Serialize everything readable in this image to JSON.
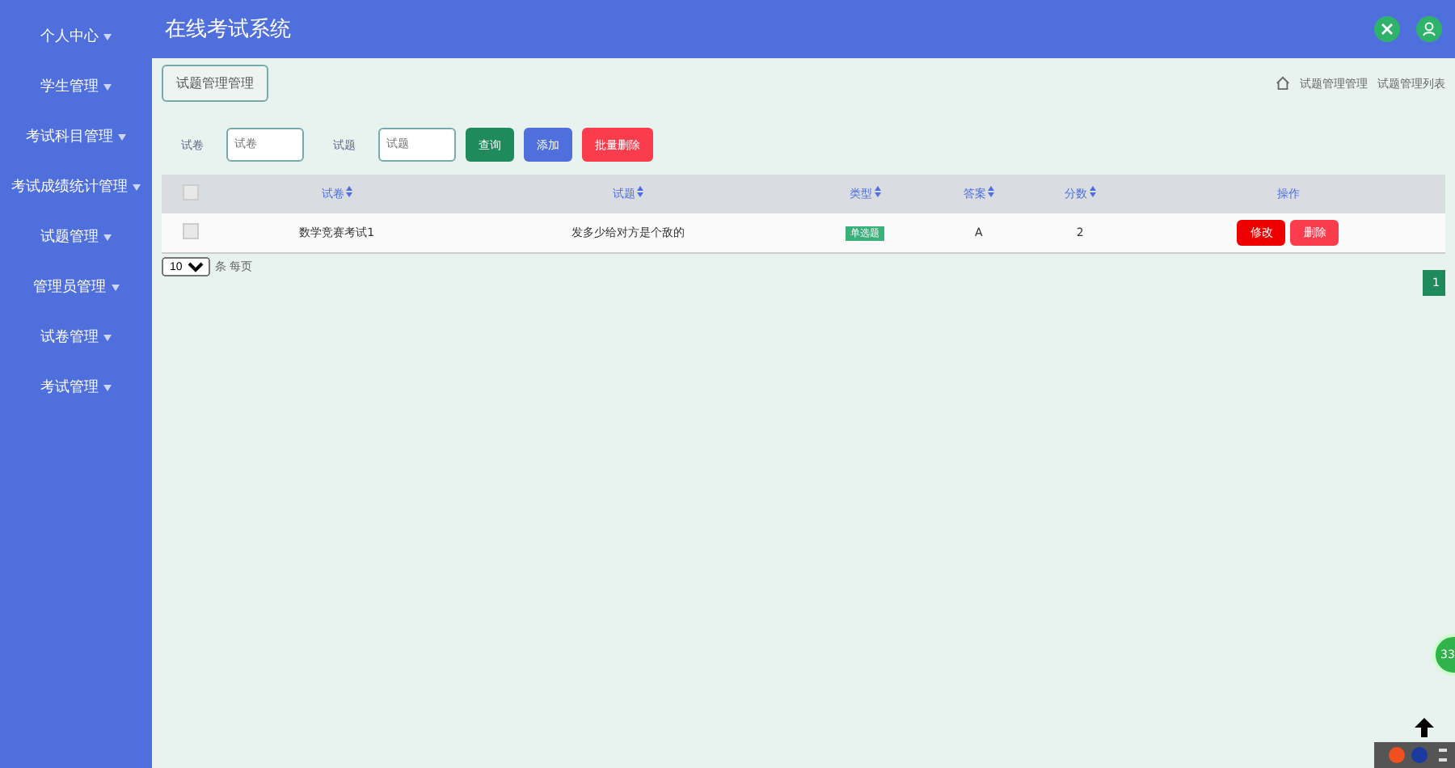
{
  "sidebar": {
    "items": [
      {
        "label": "个人中心"
      },
      {
        "label": "学生管理"
      },
      {
        "label": "考试科目管理"
      },
      {
        "label": "考试成绩统计管理"
      },
      {
        "label": "试题管理"
      },
      {
        "label": "管理员管理"
      },
      {
        "label": "试卷管理"
      },
      {
        "label": "考试管理"
      }
    ]
  },
  "header": {
    "title": "在线考试系统"
  },
  "page_tab": "试题管理管理",
  "breadcrumb": [
    "试题管理管理",
    "试题管理列表"
  ],
  "search": {
    "fields": [
      {
        "label": "试卷",
        "placeholder": "试卷"
      },
      {
        "label": "试题",
        "placeholder": "试题"
      }
    ],
    "buttons": [
      {
        "label": "查询",
        "kind": "query"
      },
      {
        "label": "添加",
        "kind": "add"
      },
      {
        "label": "批量删除",
        "kind": "delete"
      }
    ]
  },
  "table": {
    "all_checked": false,
    "columns": [
      "试卷",
      "试题",
      "类型",
      "答案",
      "分数",
      "操作"
    ],
    "rows": [
      {
        "checked": false,
        "cells": [
          "数学竞赛考试1",
          "发多少给对方是个敌的",
          "单选题",
          "A",
          "2"
        ],
        "actions": [
          {
            "label": "修改",
            "kind": "edit"
          },
          {
            "label": "删除",
            "kind": "delete"
          }
        ]
      }
    ]
  },
  "page_size": {
    "value": "10",
    "suffix": "条 每页"
  },
  "pagination": [
    {
      "label": "1",
      "selected": true
    }
  ],
  "floating_badge": "33"
}
